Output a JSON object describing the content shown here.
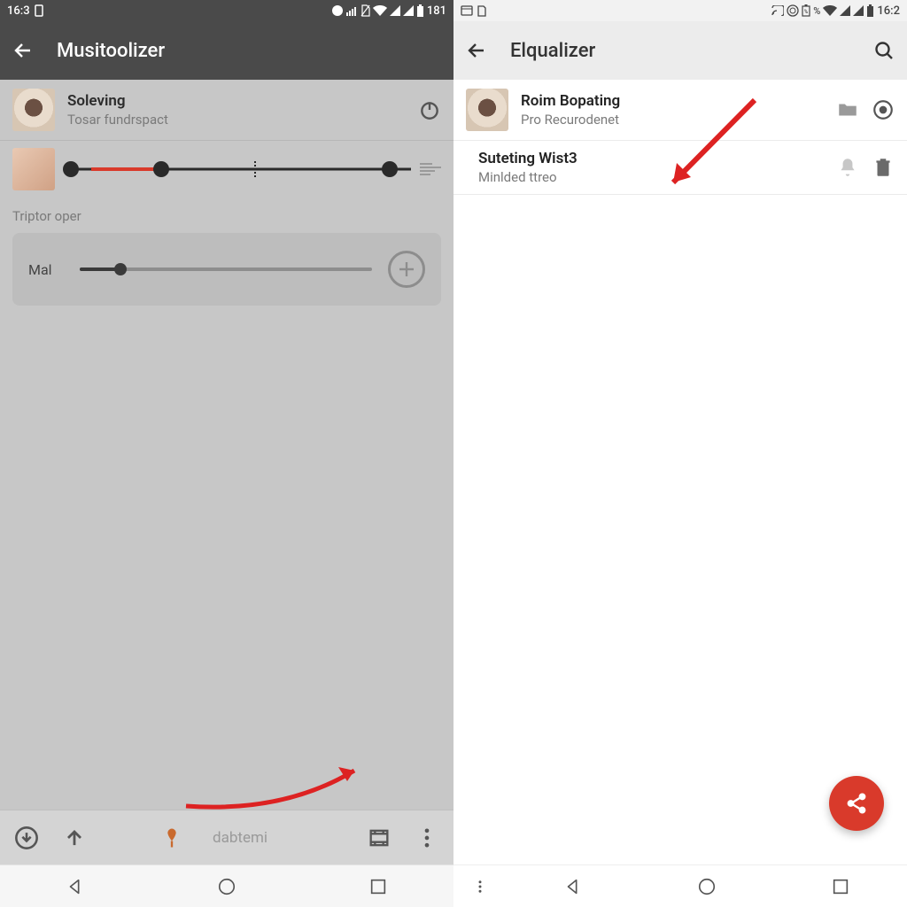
{
  "left": {
    "statusbar": {
      "time": "16:3",
      "battery": "181"
    },
    "toolbar": {
      "title": "Musitoolizer"
    },
    "item1": {
      "title": "Soleving",
      "subtitle": "Tosar fundrspact"
    },
    "caption": "Triptor oper",
    "panel": {
      "label": "Mal"
    },
    "bottom_label": "dabtemi"
  },
  "right": {
    "statusbar": {
      "time": "16:2"
    },
    "toolbar": {
      "title": "Elqualizer"
    },
    "item1": {
      "title": "Roim Bopating",
      "subtitle": "Pro Recurodenet"
    },
    "item2": {
      "title": "Suteting Wist3",
      "subtitle": "Minlded ttreo"
    }
  },
  "icons": {
    "power": "power-icon",
    "search": "search-icon",
    "folder": "folder-icon",
    "target": "target-icon"
  }
}
